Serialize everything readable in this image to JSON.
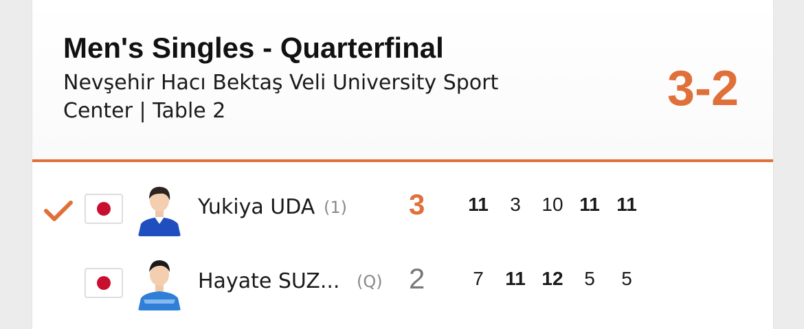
{
  "match": {
    "title": "Men's Singles - Quarterfinal",
    "venue": "Nevşehir Hacı Bektaş Veli University Sport Center | Table 2",
    "score": "3-2"
  },
  "players": [
    {
      "name": "Yukiya UDA",
      "seed": "(1)",
      "sets": "3",
      "winner": true,
      "flag_icon": "japan-flag-icon",
      "games": [
        {
          "points": "11",
          "won": true
        },
        {
          "points": "3",
          "won": false
        },
        {
          "points": "10",
          "won": false
        },
        {
          "points": "11",
          "won": true
        },
        {
          "points": "11",
          "won": true
        }
      ]
    },
    {
      "name": "Hayate SUZ...",
      "seed": "(Q)",
      "sets": "2",
      "winner": false,
      "flag_icon": "japan-flag-icon",
      "games": [
        {
          "points": "7",
          "won": false
        },
        {
          "points": "11",
          "won": true
        },
        {
          "points": "12",
          "won": true
        },
        {
          "points": "5",
          "won": false
        },
        {
          "points": "5",
          "won": false
        }
      ]
    }
  ],
  "colors": {
    "accent": "#e0703a",
    "flag_red": "#c8102e"
  }
}
